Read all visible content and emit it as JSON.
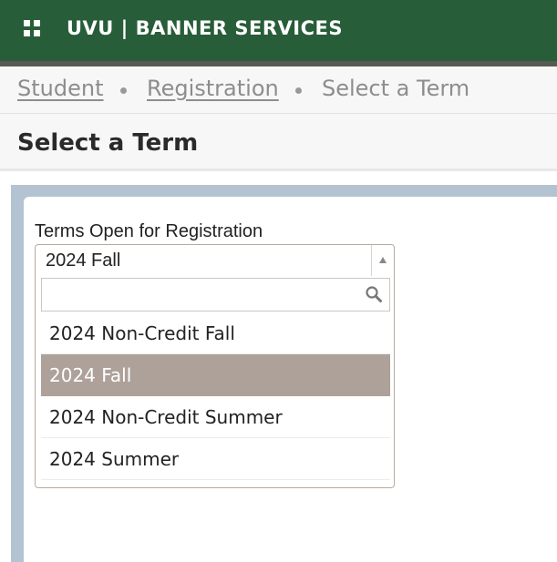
{
  "header": {
    "title": "UVU | BANNER SERVICES",
    "apps_icon": "grid-apps-icon"
  },
  "breadcrumb": [
    {
      "label": "Student",
      "link": true
    },
    {
      "label": "Registration",
      "link": true
    },
    {
      "label": "Select a Term",
      "link": false
    }
  ],
  "page": {
    "title": "Select a Term"
  },
  "term_select": {
    "label": "Terms Open for Registration",
    "value": "2024 Fall",
    "search_placeholder": "",
    "options": [
      {
        "label": "2024 Non-Credit Fall"
      },
      {
        "label": "2024 Fall"
      },
      {
        "label": "2024 Non-Credit Summer"
      },
      {
        "label": "2024 Summer"
      }
    ],
    "selected_option": "2024 Fall"
  },
  "colors": {
    "header_bg": "#275d38",
    "selected_option_bg": "#ada19a",
    "content_frame": "#b4c3d1"
  }
}
